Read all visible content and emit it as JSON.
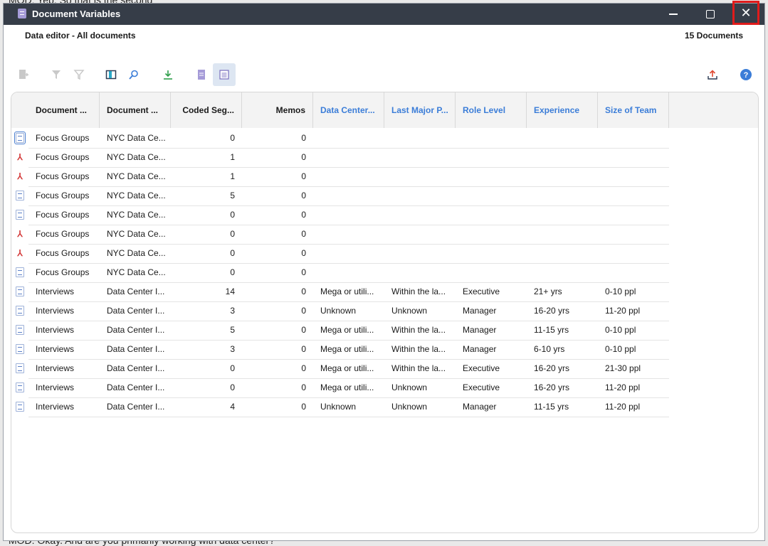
{
  "background": {
    "top_text": "MOD: Yep. So that is the second",
    "bottom_text": "MOD: Okay. And are you primarily working with data center?"
  },
  "window": {
    "title": "Document Variables",
    "close_label": "✕"
  },
  "subheader": {
    "left": "Data editor - All documents",
    "right": "15 Documents"
  },
  "toolbar": {
    "icons": [
      "document-new-icon",
      "filter-icon",
      "filter-settings-icon",
      "columns-icon",
      "search-icon",
      "download-icon",
      "document-list-icon",
      "table-view-icon",
      "export-icon",
      "help-icon"
    ]
  },
  "columns": [
    {
      "label": "Document ...",
      "blue": false,
      "align": "left"
    },
    {
      "label": "Document ...",
      "blue": false,
      "align": "left"
    },
    {
      "label": "Coded Seg...",
      "blue": false,
      "align": "right"
    },
    {
      "label": "Memos",
      "blue": false,
      "align": "right"
    },
    {
      "label": "Data Center...",
      "blue": true,
      "align": "left"
    },
    {
      "label": "Last Major P...",
      "blue": true,
      "align": "left"
    },
    {
      "label": "Role Level",
      "blue": true,
      "align": "left"
    },
    {
      "label": "Experience",
      "blue": true,
      "align": "left"
    },
    {
      "label": "Size of Team",
      "blue": true,
      "align": "left"
    }
  ],
  "rows": [
    {
      "type": "doc",
      "cells": [
        "Focus Groups",
        "NYC Data Ce...",
        "0",
        "0",
        "",
        "",
        "",
        "",
        ""
      ]
    },
    {
      "type": "pdf",
      "cells": [
        "Focus Groups",
        "NYC Data Ce...",
        "1",
        "0",
        "",
        "",
        "",
        "",
        ""
      ]
    },
    {
      "type": "pdf",
      "cells": [
        "Focus Groups",
        "NYC Data Ce...",
        "1",
        "0",
        "",
        "",
        "",
        "",
        ""
      ]
    },
    {
      "type": "doc",
      "cells": [
        "Focus Groups",
        "NYC Data Ce...",
        "5",
        "0",
        "",
        "",
        "",
        "",
        ""
      ]
    },
    {
      "type": "doc",
      "cells": [
        "Focus Groups",
        "NYC Data Ce...",
        "0",
        "0",
        "",
        "",
        "",
        "",
        ""
      ]
    },
    {
      "type": "pdf",
      "cells": [
        "Focus Groups",
        "NYC Data Ce...",
        "0",
        "0",
        "",
        "",
        "",
        "",
        ""
      ]
    },
    {
      "type": "pdf",
      "cells": [
        "Focus Groups",
        "NYC Data Ce...",
        "0",
        "0",
        "",
        "",
        "",
        "",
        ""
      ]
    },
    {
      "type": "doc",
      "cells": [
        "Focus Groups",
        "NYC Data Ce...",
        "0",
        "0",
        "",
        "",
        "",
        "",
        ""
      ]
    },
    {
      "type": "doc",
      "cells": [
        "Interviews",
        "Data Center I...",
        "14",
        "0",
        "Mega or utili...",
        "Within the la...",
        "Executive",
        "21+ yrs",
        "0-10 ppl"
      ]
    },
    {
      "type": "doc",
      "cells": [
        "Interviews",
        "Data Center I...",
        "3",
        "0",
        "Unknown",
        "Unknown",
        "Manager",
        "16-20 yrs",
        "11-20 ppl"
      ]
    },
    {
      "type": "doc",
      "cells": [
        "Interviews",
        "Data Center I...",
        "5",
        "0",
        "Mega or utili...",
        "Within the la...",
        "Manager",
        "11-15 yrs",
        "0-10 ppl"
      ]
    },
    {
      "type": "doc",
      "cells": [
        "Interviews",
        "Data Center I...",
        "3",
        "0",
        "Mega or utili...",
        "Within the la...",
        "Manager",
        "6-10 yrs",
        "0-10 ppl"
      ]
    },
    {
      "type": "doc",
      "cells": [
        "Interviews",
        "Data Center I...",
        "0",
        "0",
        "Mega or utili...",
        "Within the la...",
        "Executive",
        "16-20 yrs",
        "21-30 ppl"
      ]
    },
    {
      "type": "doc",
      "cells": [
        "Interviews",
        "Data Center I...",
        "0",
        "0",
        "Mega or utili...",
        "Unknown",
        "Executive",
        "16-20 yrs",
        "11-20 ppl"
      ]
    },
    {
      "type": "doc",
      "cells": [
        "Interviews",
        "Data Center I...",
        "4",
        "0",
        "Unknown",
        "Unknown",
        "Manager",
        "11-15 yrs",
        "11-20 ppl"
      ]
    }
  ]
}
